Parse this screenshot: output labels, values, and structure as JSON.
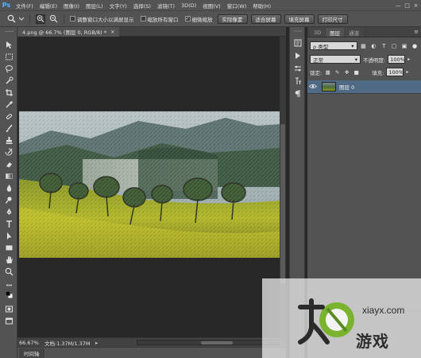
{
  "app": {
    "logo": "Ps"
  },
  "menu": [
    "文件(F)",
    "编辑(E)",
    "图像(I)",
    "图层(L)",
    "文字(Y)",
    "选择(S)",
    "滤镜(T)",
    "3D(D)",
    "视图(V)",
    "窗口(W)",
    "帮助(H)"
  ],
  "window_controls": {
    "minimize": "—",
    "maximize": "□",
    "close": "×"
  },
  "options_bar": {
    "tool_icon": "zoom-icon",
    "resize_windows": "调整窗口大小以满屏显示",
    "zoom_all_windows": "缩放所有窗口",
    "scrubby_zoom": "细微缩放",
    "scrubby_checked": "✓",
    "actual_pixels": "实际像素",
    "fit_screen": "适合屏幕",
    "fill_screen": "填充屏幕",
    "print_size": "打印尺寸"
  },
  "document": {
    "tab_title": "4.png @ 66.7% (图层 0, RGB/8) *",
    "close": "×"
  },
  "status": {
    "zoom": "66.67%",
    "doc_info": "文档:1.37M/1.37M",
    "arrow": "▸"
  },
  "timeline": {
    "label": "时间轴"
  },
  "layers_panel": {
    "tabs": [
      "3D",
      "图层",
      "通道"
    ],
    "active_tab": 1,
    "menu_icon": "≡",
    "filter_label": "ρ 类型",
    "blend_mode": "正常",
    "opacity_label": "不透明度:",
    "opacity_value": "100%",
    "lock_label": "锁定:",
    "fill_label": "填充:",
    "fill_value": "100%",
    "layer_name": "图层 0",
    "eye": "●"
  },
  "watermark": {
    "url": "xiayx.com",
    "brand": "游戏",
    "accent": "#7ab32e"
  },
  "colors": {
    "panel": "#535353",
    "canvas_bg": "#282828",
    "selected_layer": "#4f6a84",
    "ps_blue": "#59b1ff"
  }
}
